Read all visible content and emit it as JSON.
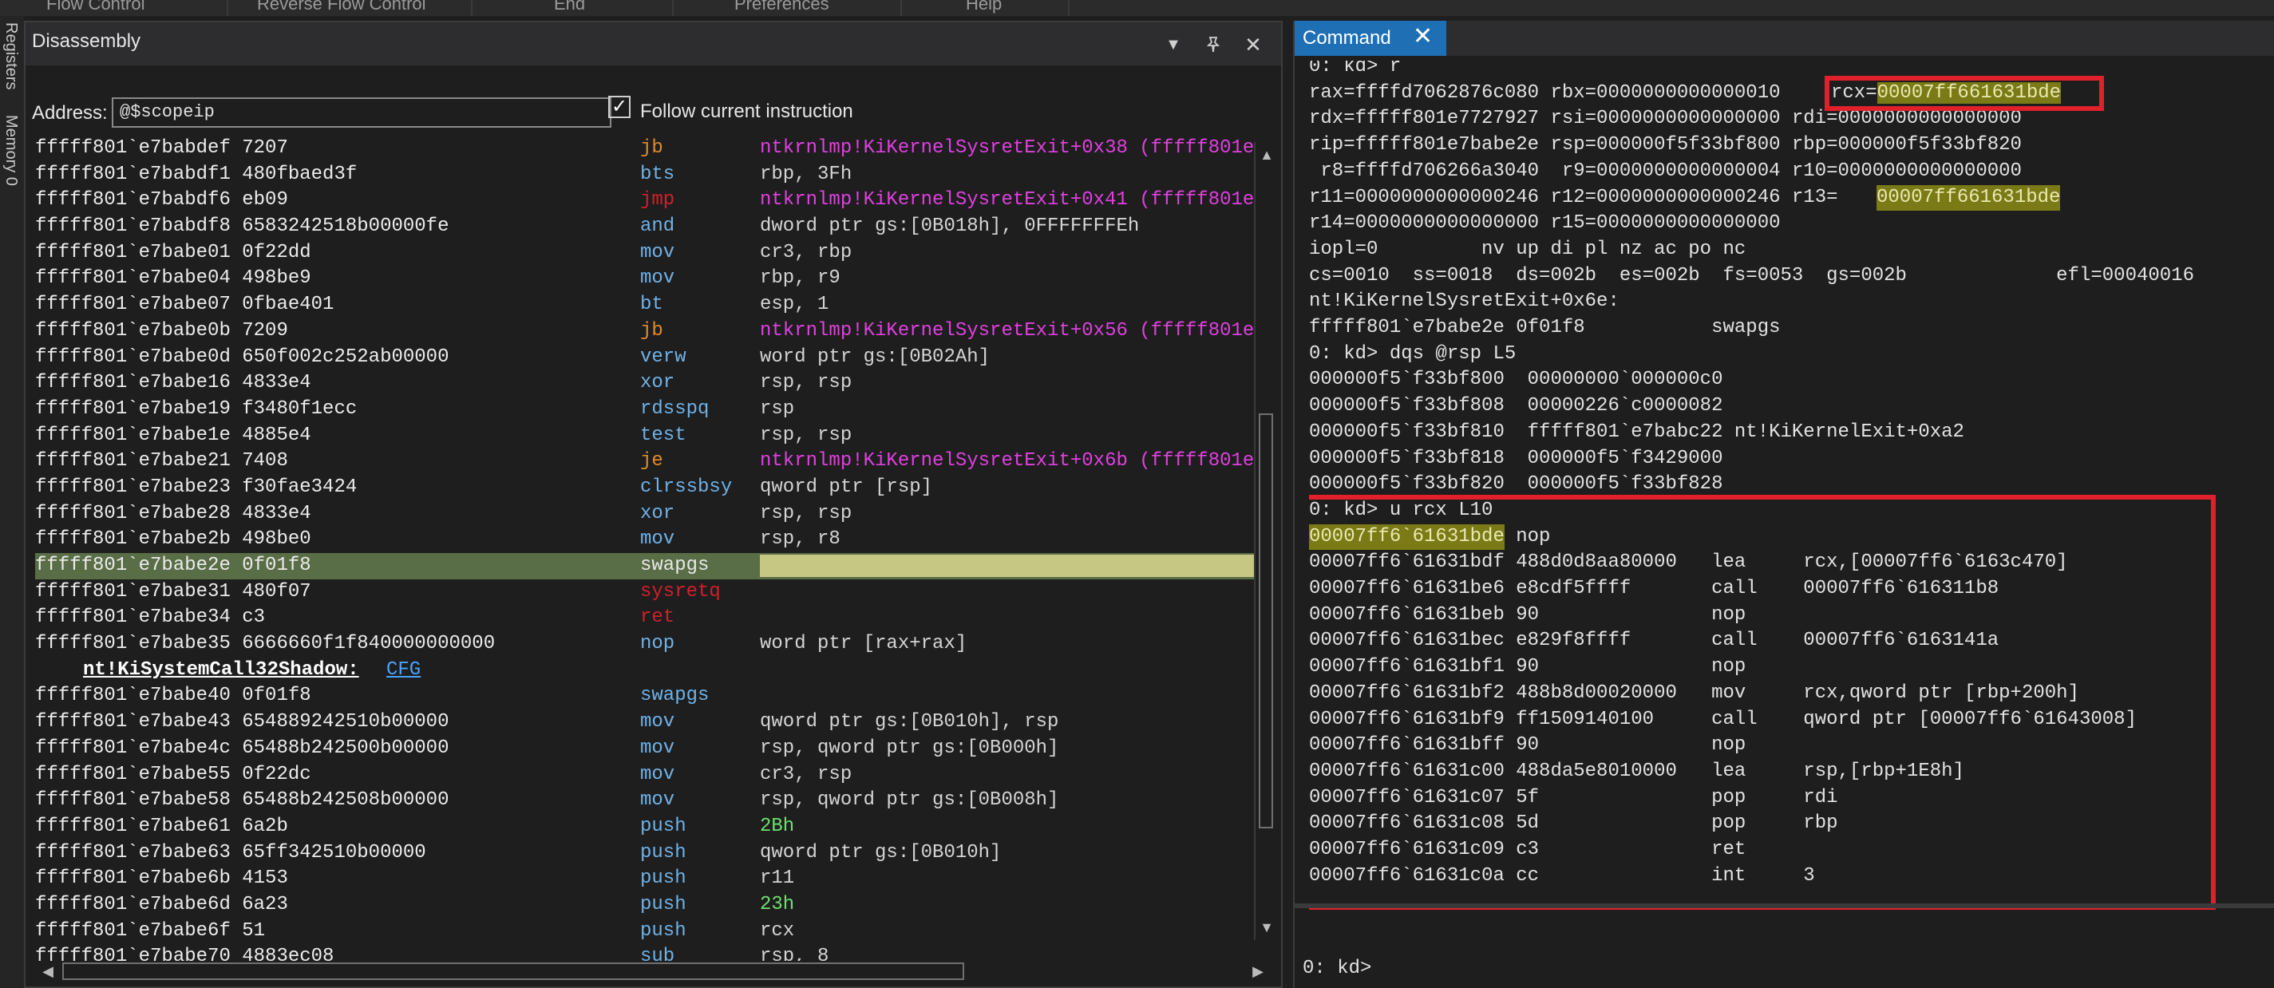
{
  "menubar": {
    "items": [
      "Flow Control",
      "Reverse Flow Control",
      "End",
      "Preferences",
      "Help"
    ]
  },
  "left_strip": {
    "tabs": [
      "Registers",
      "Memory 0"
    ]
  },
  "disassembly": {
    "title": "Disassembly",
    "address_label": "Address:",
    "address_value": "@$scopeip",
    "follow_label": "Follow current instruction",
    "follow_checked": true,
    "lines": [
      {
        "addr": "fffff801`e7babdef 7207",
        "mn": "jb",
        "op": "ntkrnlmp!KiKernelSysretExit+0x38 (fffff801e",
        "mncolor": "#e08a2c",
        "opcolor": "#e040e0"
      },
      {
        "addr": "fffff801`e7babdf1 480fbaed3f",
        "mn": "bts",
        "op": "rbp, 3Fh",
        "mncolor": "#6fb2e8",
        "opcolor": "#d4d4d4"
      },
      {
        "addr": "fffff801`e7babdf6 eb09",
        "mn": "jmp",
        "op": "ntkrnlmp!KiKernelSysretExit+0x41 (fffff801e",
        "mncolor": "#d0202a",
        "opcolor": "#e040e0"
      },
      {
        "addr": "fffff801`e7babdf8 6583242518b00000fe",
        "mn": "and",
        "op": "dword ptr gs:[0B018h], 0FFFFFFFEh",
        "mncolor": "#6fb2e8",
        "opcolor": "#d4d4d4"
      },
      {
        "addr": "fffff801`e7babe01 0f22dd",
        "mn": "mov",
        "op": "cr3, rbp",
        "mncolor": "#6fb2e8",
        "opcolor": "#d4d4d4"
      },
      {
        "addr": "fffff801`e7babe04 498be9",
        "mn": "mov",
        "op": "rbp, r9",
        "mncolor": "#6fb2e8",
        "opcolor": "#d4d4d4"
      },
      {
        "addr": "fffff801`e7babe07 0fbae401",
        "mn": "bt",
        "op": "esp, 1",
        "mncolor": "#6fb2e8",
        "opcolor": "#d4d4d4"
      },
      {
        "addr": "fffff801`e7babe0b 7209",
        "mn": "jb",
        "op": "ntkrnlmp!KiKernelSysretExit+0x56 (fffff801e",
        "mncolor": "#e08a2c",
        "opcolor": "#e040e0"
      },
      {
        "addr": "fffff801`e7babe0d 650f002c252ab00000",
        "mn": "verw",
        "op": "word ptr gs:[0B02Ah]",
        "mncolor": "#6fb2e8",
        "opcolor": "#d4d4d4"
      },
      {
        "addr": "fffff801`e7babe16 4833e4",
        "mn": "xor",
        "op": "rsp, rsp",
        "mncolor": "#6fb2e8",
        "opcolor": "#d4d4d4"
      },
      {
        "addr": "fffff801`e7babe19 f3480f1ecc",
        "mn": "rdsspq",
        "op": "rsp",
        "mncolor": "#6fb2e8",
        "opcolor": "#d4d4d4"
      },
      {
        "addr": "fffff801`e7babe1e 4885e4",
        "mn": "test",
        "op": "rsp, rsp",
        "mncolor": "#6fb2e8",
        "opcolor": "#d4d4d4"
      },
      {
        "addr": "fffff801`e7babe21 7408",
        "mn": "je",
        "op": "ntkrnlmp!KiKernelSysretExit+0x6b (fffff801e",
        "mncolor": "#e08a2c",
        "opcolor": "#e040e0"
      },
      {
        "addr": "fffff801`e7babe23 f30fae3424",
        "mn": "clrssbsy",
        "op": "qword ptr [rsp]",
        "mncolor": "#6fb2e8",
        "opcolor": "#d4d4d4"
      },
      {
        "addr": "fffff801`e7babe28 4833e4",
        "mn": "xor",
        "op": "rsp, rsp",
        "mncolor": "#6fb2e8",
        "opcolor": "#d4d4d4"
      },
      {
        "addr": "fffff801`e7babe2b 498be0",
        "mn": "mov",
        "op": "rsp, r8",
        "mncolor": "#6fb2e8",
        "opcolor": "#d4d4d4"
      },
      {
        "addr": "fffff801`e7babe2e 0f01f8",
        "mn": "swapgs",
        "op": "",
        "mncolor": "#e8e8e8",
        "opcolor": "#d4d4d4",
        "current": true
      },
      {
        "addr": "fffff801`e7babe31 480f07",
        "mn": "sysretq",
        "op": "",
        "mncolor": "#d0202a",
        "opcolor": "#d4d4d4"
      },
      {
        "addr": "fffff801`e7babe34 c3",
        "mn": "ret",
        "op": "",
        "mncolor": "#d0202a",
        "opcolor": "#d4d4d4"
      },
      {
        "addr": "fffff801`e7babe35 6666660f1f840000000000",
        "mn": "nop",
        "op": "word ptr [rax+rax]",
        "mncolor": "#6fb2e8",
        "opcolor": "#d4d4d4"
      },
      {
        "label": "nt!KiSystemCall32Shadow:",
        "cfg": "CFG"
      },
      {
        "addr": "fffff801`e7babe40 0f01f8",
        "mn": "swapgs",
        "op": "",
        "mncolor": "#6fb2e8",
        "opcolor": "#d4d4d4"
      },
      {
        "addr": "fffff801`e7babe43 654889242510b00000",
        "mn": "mov",
        "op": "qword ptr gs:[0B010h], rsp",
        "mncolor": "#6fb2e8",
        "opcolor": "#d4d4d4"
      },
      {
        "addr": "fffff801`e7babe4c 65488b242500b00000",
        "mn": "mov",
        "op": "rsp, qword ptr gs:[0B000h]",
        "mncolor": "#6fb2e8",
        "opcolor": "#d4d4d4"
      },
      {
        "addr": "fffff801`e7babe55 0f22dc",
        "mn": "mov",
        "op": "cr3, rsp",
        "mncolor": "#6fb2e8",
        "opcolor": "#d4d4d4"
      },
      {
        "addr": "fffff801`e7babe58 65488b242508b00000",
        "mn": "mov",
        "op": "rsp, qword ptr gs:[0B008h]",
        "mncolor": "#6fb2e8",
        "opcolor": "#d4d4d4"
      },
      {
        "addr": "fffff801`e7babe61 6a2b",
        "mn": "push",
        "op": "2Bh",
        "mncolor": "#6fb2e8",
        "opcolor": "#6ee06e"
      },
      {
        "addr": "fffff801`e7babe63 65ff342510b00000",
        "mn": "push",
        "op": "qword ptr gs:[0B010h]",
        "mncolor": "#6fb2e8",
        "opcolor": "#d4d4d4"
      },
      {
        "addr": "fffff801`e7babe6b 4153",
        "mn": "push",
        "op": "r11",
        "mncolor": "#6fb2e8",
        "opcolor": "#d4d4d4"
      },
      {
        "addr": "fffff801`e7babe6d 6a23",
        "mn": "push",
        "op": "23h",
        "mncolor": "#6fb2e8",
        "opcolor": "#6ee06e"
      },
      {
        "addr": "fffff801`e7babe6f 51",
        "mn": "push",
        "op": "rcx",
        "mncolor": "#6fb2e8",
        "opcolor": "#d4d4d4"
      },
      {
        "addr": "fffff801`e7babe70 4883ec08",
        "mn": "sub",
        "op": "rsp, 8",
        "mncolor": "#6fb2e8",
        "opcolor": "#d4d4d4"
      }
    ]
  },
  "command": {
    "tab_label": "Command",
    "prompt": "0: kd>",
    "lines": [
      "0: kd> r",
      "rax=ffffd7062876c080 rbx=0000000000000010",
      "rdx=fffff801e7727927 rsi=0000000000000000 rdi=0000000000000000",
      "rip=fffff801e7babe2e rsp=000000f5f33bf800 rbp=000000f5f33bf820",
      " r8=ffffd706266a3040  r9=0000000000000004 r10=0000000000000000",
      "r11=0000000000000246 r12=0000000000000246 r13=",
      "r14=0000000000000000 r15=0000000000000000",
      "iopl=0         nv up di pl nz ac po nc",
      "cs=0010  ss=0018  ds=002b  es=002b  fs=0053  gs=002b             efl=00040016",
      "nt!KiKernelSysretExit+0x6e:",
      "fffff801`e7babe2e 0f01f8           swapgs",
      "0: kd> dqs @rsp L5",
      "000000f5`f33bf800  00000000`000000c0",
      "000000f5`f33bf808  00000226`c0000082",
      "000000f5`f33bf810  fffff801`e7babc22 nt!KiKernelExit+0xa2",
      "000000f5`f33bf818  000000f5`f3429000",
      "000000f5`f33bf820  000000f5`f33bf828",
      "0: kd> u rcx L10",
      " 90               nop",
      "00007ff6`61631bdf 488d0d8aa80000   lea     rcx,[00007ff6`6163c470]",
      "00007ff6`61631be6 e8cdf5ffff       call    00007ff6`616311b8",
      "00007ff6`61631beb 90               nop",
      "00007ff6`61631bec e829f8ffff       call    00007ff6`6163141a",
      "00007ff6`61631bf1 90               nop",
      "00007ff6`61631bf2 488b8d00020000   mov     rcx,qword ptr [rbp+200h]",
      "00007ff6`61631bf9 ff1509140100     call    qword ptr [00007ff6`61643008]",
      "00007ff6`61631bff 90               nop",
      "00007ff6`61631c00 488da5e8010000   lea     rsp,[rbp+1E8h]",
      "00007ff6`61631c07 5f               pop     rdi",
      "00007ff6`61631c08 5d               pop     rbp",
      "00007ff6`61631c09 c3               ret",
      "00007ff6`61631c0a cc               int     3"
    ],
    "rcx_label": "rcx=",
    "rcx_value": "00007ff661631bde",
    "r13_value": "00007ff661631bde",
    "u_first_addr": "00007ff6`61631bde"
  }
}
